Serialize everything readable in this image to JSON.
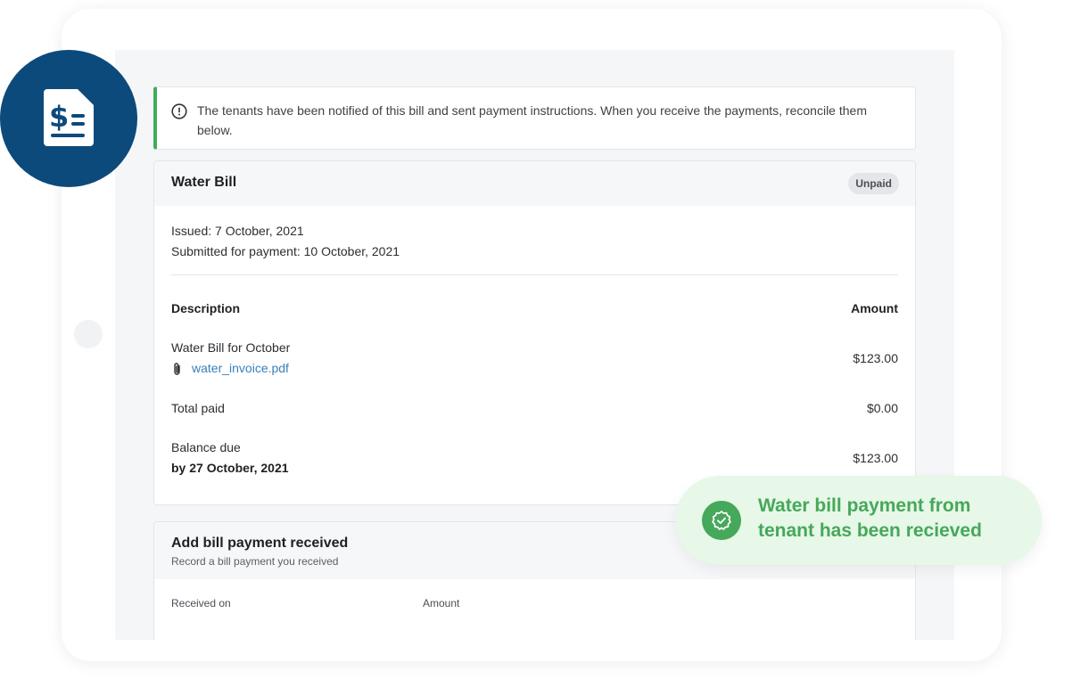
{
  "notice": {
    "message": "The tenants have been notified of this bill and sent payment instructions. When you receive the payments, reconcile them below."
  },
  "bill": {
    "title": "Water Bill",
    "status": "Unpaid",
    "issued": "Issued: 7 October, 2021",
    "submitted": "Submitted for payment: 10 October, 2021",
    "columns": {
      "description": "Description",
      "amount": "Amount"
    },
    "line_item": {
      "description": "Water Bill for October",
      "attachment": "water_invoice.pdf",
      "amount": "$123.00"
    },
    "total_paid": {
      "label": "Total paid",
      "amount": "$0.00"
    },
    "balance_due": {
      "label": "Balance due",
      "due_date": "by 27 October, 2021",
      "amount": "$123.00"
    }
  },
  "payment_form": {
    "title": "Add bill payment received",
    "subtitle": "Record a bill payment you received",
    "received_on_label": "Received on",
    "amount_label": "Amount"
  },
  "toast": {
    "message_line1": "Water bill payment from",
    "message_line2": "tenant has been recieved"
  },
  "colors": {
    "brand_blue": "#0d4a7c",
    "success_green": "#46a85a",
    "toast_bg": "#e7f7e8",
    "link_blue": "#3a7fb8"
  },
  "icons": {
    "app_badge": "invoice-dollar-icon",
    "notice": "info-circle-icon",
    "attachment": "paperclip-icon",
    "toast": "verified-badge-icon"
  }
}
